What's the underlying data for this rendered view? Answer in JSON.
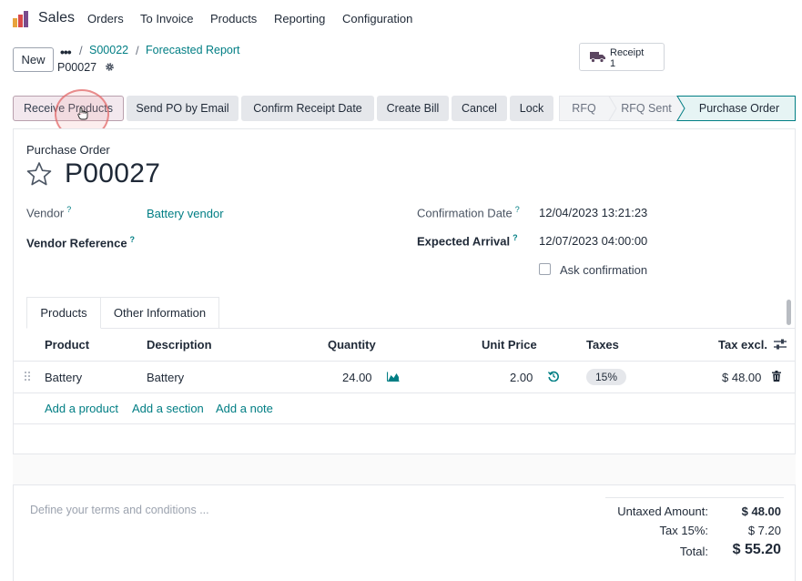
{
  "app": {
    "name": "Sales",
    "menu": [
      "Orders",
      "To Invoice",
      "Products",
      "Reporting",
      "Configuration"
    ]
  },
  "control_panel": {
    "new_label": "New",
    "breadcrumb": [
      "S00022",
      "Forecasted Report"
    ],
    "current": "P00027"
  },
  "smart_button": {
    "label": "Receipt",
    "value": "1"
  },
  "statusbar": {
    "buttons": [
      "Receive Products",
      "Send PO by Email",
      "Confirm Receipt Date",
      "Create Bill",
      "Cancel",
      "Lock"
    ],
    "stages": [
      "RFQ",
      "RFQ Sent",
      "Purchase Order"
    ],
    "active_stage": "Purchase Order"
  },
  "form": {
    "doc_type": "Purchase Order",
    "name": "P00027",
    "vendor_label": "Vendor",
    "vendor": "Battery vendor",
    "vendor_ref_label": "Vendor Reference",
    "confirmation_label": "Confirmation Date",
    "confirmation_date": "12/04/2023 13:21:23",
    "arrival_label": "Expected Arrival",
    "arrival_date": "12/07/2023 04:00:00",
    "ask_confirmation": "Ask confirmation",
    "help_mark": "?"
  },
  "tabs": [
    "Products",
    "Other Information"
  ],
  "lines": {
    "headers": [
      "Product",
      "Description",
      "Quantity",
      "Unit Price",
      "Taxes",
      "Tax excl."
    ],
    "rows": [
      {
        "product": "Battery",
        "description": "Battery",
        "quantity": "24.00",
        "unit_price": "2.00",
        "taxes": "15%",
        "subtotal": "$ 48.00"
      }
    ],
    "add_links": [
      "Add a product",
      "Add a section",
      "Add a note"
    ]
  },
  "footer": {
    "terms_placeholder": "Define your terms and conditions ...",
    "untaxed_label": "Untaxed Amount:",
    "untaxed_value": "$ 48.00",
    "tax_label": "Tax 15%:",
    "tax_value": "$ 7.20",
    "total_label": "Total:",
    "total_value": "$ 55.20"
  },
  "colors": {
    "link": "#017e84",
    "primary_btn_bg": "#f3e8ee",
    "active_stage_bg": "#e6f4f4",
    "active_stage_border": "#017e84"
  }
}
